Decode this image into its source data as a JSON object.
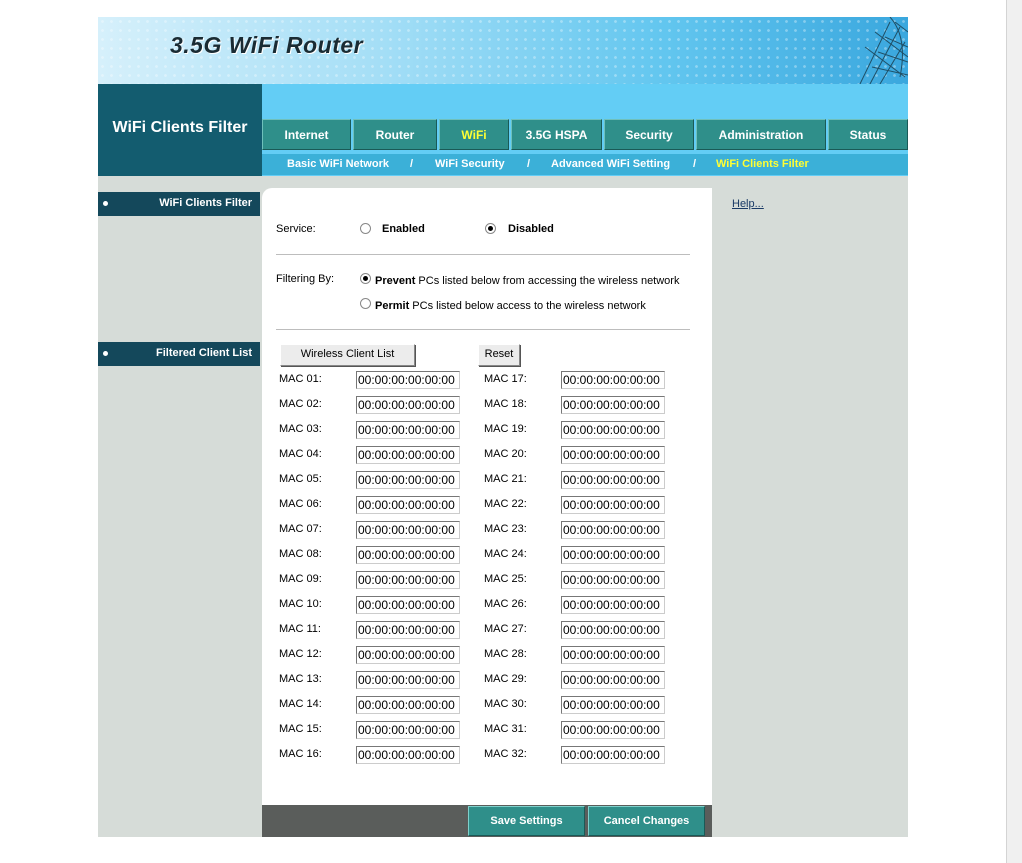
{
  "banner": {
    "title": "3.5G WiFi Router"
  },
  "header": {
    "page_name": "WiFi Clients Filter",
    "tabs": [
      {
        "label": "Internet",
        "active": false
      },
      {
        "label": "Router",
        "active": false
      },
      {
        "label": "WiFi",
        "active": true
      },
      {
        "label": "3.5G HSPA",
        "active": false
      },
      {
        "label": "Security",
        "active": false
      },
      {
        "label": "Administration",
        "active": false
      },
      {
        "label": "Status",
        "active": false
      }
    ],
    "subnav": [
      {
        "label": "Basic WiFi Network",
        "active": false
      },
      {
        "sep": "/"
      },
      {
        "label": "WiFi Security",
        "active": false
      },
      {
        "sep": "/"
      },
      {
        "label": "Advanced WiFi Setting",
        "active": false
      },
      {
        "sep": "/"
      },
      {
        "label": "WiFi Clients Filter",
        "active": true
      }
    ],
    "active_color": "#ffff33"
  },
  "sidebar": {
    "section1": "WiFi Clients Filter",
    "section2": "Filtered Client List"
  },
  "help": {
    "link": "Help..."
  },
  "service": {
    "label": "Service:",
    "enabled_label": "Enabled",
    "disabled_label": "Disabled",
    "selected": "disabled"
  },
  "filtering": {
    "label": "Filtering By:",
    "prevent_bold": "Prevent",
    "prevent_rest": " PCs listed below  from accessing the wireless network",
    "permit_bold": "Permit",
    "permit_rest": " PCs listed below access to the wireless network",
    "selected": "prevent"
  },
  "buttons": {
    "client_list": "Wireless Client List",
    "reset": "Reset",
    "save": "Save Settings",
    "cancel": "Cancel Changes"
  },
  "mac": {
    "left": [
      {
        "label": "MAC 01:",
        "value": "00:00:00:00:00:00"
      },
      {
        "label": "MAC 02:",
        "value": "00:00:00:00:00:00"
      },
      {
        "label": "MAC 03:",
        "value": "00:00:00:00:00:00"
      },
      {
        "label": "MAC 04:",
        "value": "00:00:00:00:00:00"
      },
      {
        "label": "MAC 05:",
        "value": "00:00:00:00:00:00"
      },
      {
        "label": "MAC 06:",
        "value": "00:00:00:00:00:00"
      },
      {
        "label": "MAC 07:",
        "value": "00:00:00:00:00:00"
      },
      {
        "label": "MAC 08:",
        "value": "00:00:00:00:00:00"
      },
      {
        "label": "MAC 09:",
        "value": "00:00:00:00:00:00"
      },
      {
        "label": "MAC 10:",
        "value": "00:00:00:00:00:00"
      },
      {
        "label": "MAC 11:",
        "value": "00:00:00:00:00:00"
      },
      {
        "label": "MAC 12:",
        "value": "00:00:00:00:00:00"
      },
      {
        "label": "MAC 13:",
        "value": "00:00:00:00:00:00"
      },
      {
        "label": "MAC 14:",
        "value": "00:00:00:00:00:00"
      },
      {
        "label": "MAC 15:",
        "value": "00:00:00:00:00:00"
      },
      {
        "label": "MAC 16:",
        "value": "00:00:00:00:00:00"
      }
    ],
    "right": [
      {
        "label": "MAC 17:",
        "value": "00:00:00:00:00:00"
      },
      {
        "label": "MAC 18:",
        "value": "00:00:00:00:00:00"
      },
      {
        "label": "MAC 19:",
        "value": "00:00:00:00:00:00"
      },
      {
        "label": "MAC 20:",
        "value": "00:00:00:00:00:00"
      },
      {
        "label": "MAC 21:",
        "value": "00:00:00:00:00:00"
      },
      {
        "label": "MAC 22:",
        "value": "00:00:00:00:00:00"
      },
      {
        "label": "MAC 23:",
        "value": "00:00:00:00:00:00"
      },
      {
        "label": "MAC 24:",
        "value": "00:00:00:00:00:00"
      },
      {
        "label": "MAC 25:",
        "value": "00:00:00:00:00:00"
      },
      {
        "label": "MAC 26:",
        "value": "00:00:00:00:00:00"
      },
      {
        "label": "MAC 27:",
        "value": "00:00:00:00:00:00"
      },
      {
        "label": "MAC 28:",
        "value": "00:00:00:00:00:00"
      },
      {
        "label": "MAC 29:",
        "value": "00:00:00:00:00:00"
      },
      {
        "label": "MAC 30:",
        "value": "00:00:00:00:00:00"
      },
      {
        "label": "MAC 31:",
        "value": "00:00:00:00:00:00"
      },
      {
        "label": "MAC 32:",
        "value": "00:00:00:00:00:00"
      }
    ]
  }
}
